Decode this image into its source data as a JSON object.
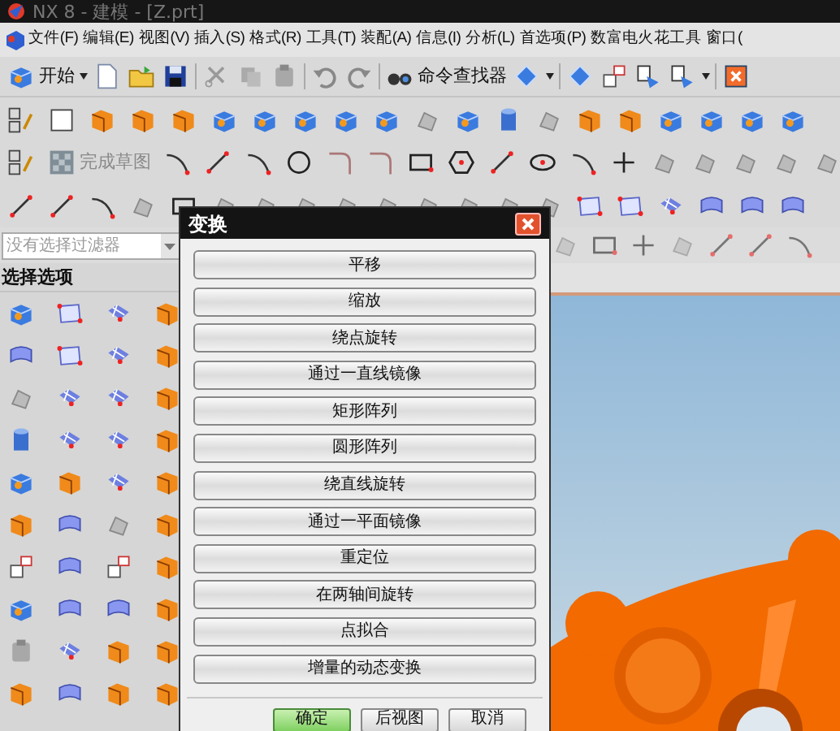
{
  "window": {
    "title": "NX 8 - 建模 - [Z.prt]"
  },
  "menu": [
    "文件(F)",
    "编辑(E)",
    "视图(V)",
    "插入(S)",
    "格式(R)",
    "工具(T)",
    "装配(A)",
    "信息(I)",
    "分析(L)",
    "首选项(P)",
    "数富电火花工具",
    "窗口("
  ],
  "toolbar": {
    "start_button": "开始",
    "command_finder": "命令查找器"
  },
  "sketch_toolbar": {
    "finish_sketch": "完成草图"
  },
  "selection_filter": {
    "value": "没有选择过滤器"
  },
  "panel": {
    "title": "选择选项"
  },
  "dialog": {
    "title": "变换",
    "options": [
      "平移",
      "缩放",
      "绕点旋转",
      "通过一直线镜像",
      "矩形阵列",
      "圆形阵列",
      "绕直线旋转",
      "通过一平面镜像",
      "重定位",
      "在两轴间旋转",
      "点拟合",
      "增量的动态变换"
    ],
    "buttons": [
      {
        "label": "确定",
        "kind": "default"
      },
      {
        "label": "后视图",
        "kind": "normal"
      },
      {
        "label": "取消",
        "kind": "normal"
      }
    ]
  }
}
